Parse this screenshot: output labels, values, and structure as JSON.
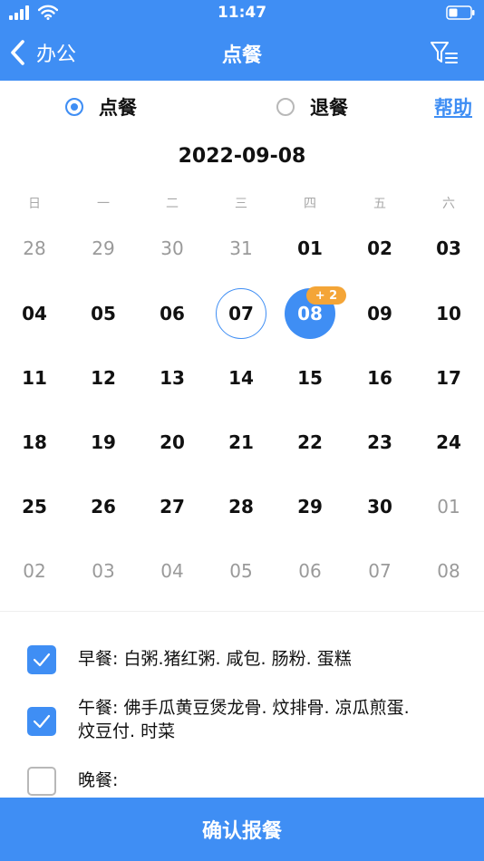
{
  "status_bar": {
    "time": "11:47"
  },
  "nav": {
    "back_label": "办公",
    "title": "点餐",
    "icons": {
      "back": "chevron-left-icon",
      "filter": "filter-list-icon"
    }
  },
  "mode": {
    "order_label": "点餐",
    "cancel_label": "退餐",
    "selected": "order",
    "help_label": "帮助"
  },
  "calendar": {
    "date_title": "2022-09-08",
    "weekdays": [
      "日",
      "一",
      "二",
      "三",
      "四",
      "五",
      "六"
    ],
    "weeks": [
      [
        {
          "label": "28",
          "muted": true
        },
        {
          "label": "29",
          "muted": true
        },
        {
          "label": "30",
          "muted": true
        },
        {
          "label": "31",
          "muted": true
        },
        {
          "label": "01",
          "muted": false
        },
        {
          "label": "02",
          "muted": false
        },
        {
          "label": "03",
          "muted": false
        }
      ],
      [
        {
          "label": "04",
          "muted": false
        },
        {
          "label": "05",
          "muted": false
        },
        {
          "label": "06",
          "muted": false
        },
        {
          "label": "07",
          "muted": false,
          "today": true
        },
        {
          "label": "08",
          "muted": false,
          "selected": true
        },
        {
          "label": "09",
          "muted": false
        },
        {
          "label": "10",
          "muted": false
        }
      ],
      [
        {
          "label": "11",
          "muted": false
        },
        {
          "label": "12",
          "muted": false
        },
        {
          "label": "13",
          "muted": false
        },
        {
          "label": "14",
          "muted": false
        },
        {
          "label": "15",
          "muted": false
        },
        {
          "label": "16",
          "muted": false
        },
        {
          "label": "17",
          "muted": false
        }
      ],
      [
        {
          "label": "18",
          "muted": false
        },
        {
          "label": "19",
          "muted": false
        },
        {
          "label": "20",
          "muted": false
        },
        {
          "label": "21",
          "muted": false
        },
        {
          "label": "22",
          "muted": false
        },
        {
          "label": "23",
          "muted": false
        },
        {
          "label": "24",
          "muted": false
        }
      ],
      [
        {
          "label": "25",
          "muted": false
        },
        {
          "label": "26",
          "muted": false
        },
        {
          "label": "27",
          "muted": false
        },
        {
          "label": "28",
          "muted": false
        },
        {
          "label": "29",
          "muted": false
        },
        {
          "label": "30",
          "muted": false
        },
        {
          "label": "01",
          "muted": true
        }
      ],
      [
        {
          "label": "02",
          "muted": true
        },
        {
          "label": "03",
          "muted": true
        },
        {
          "label": "04",
          "muted": true
        },
        {
          "label": "05",
          "muted": true
        },
        {
          "label": "06",
          "muted": true
        },
        {
          "label": "07",
          "muted": true
        },
        {
          "label": "08",
          "muted": true
        }
      ]
    ],
    "selected_badge": "+ 2"
  },
  "meals": [
    {
      "text": "早餐: 白粥.猪红粥. 咸包. 肠粉. 蛋糕",
      "checked": true
    },
    {
      "text": "午餐: 佛手瓜黄豆煲龙骨. 炆排骨. 凉瓜煎蛋. 炆豆付. 时菜",
      "checked": true
    },
    {
      "text": "晚餐:",
      "checked": false
    }
  ],
  "confirm_label": "确认报餐",
  "colors": {
    "accent": "#3f8ef4",
    "badge": "#f4a537",
    "muted_text": "#9a9a9a"
  }
}
